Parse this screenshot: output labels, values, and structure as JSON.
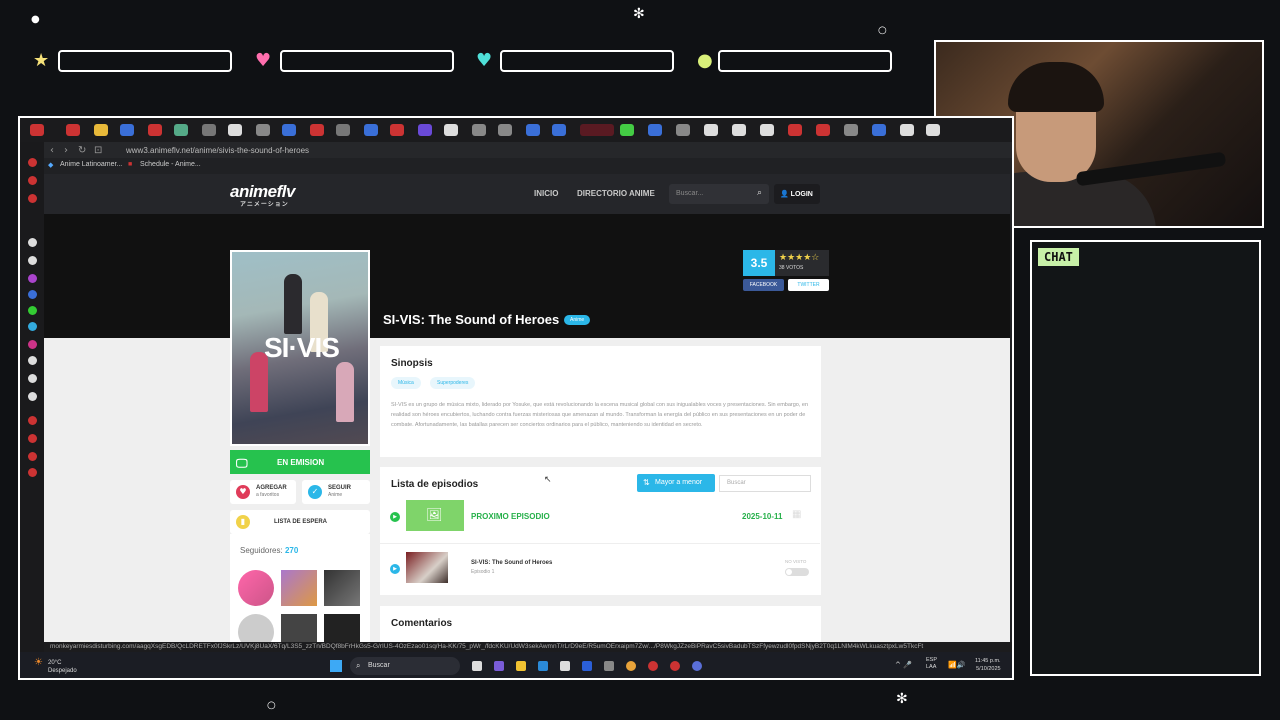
{
  "overlay": {
    "chat_label": "CHAT"
  },
  "browser": {
    "url": "www3.animeflv.net/anime/sivis-the-sound-of-heroes",
    "active_tab": "SI-VIS",
    "bookmarks": [
      "Anime Latinoamer...",
      "Schedule - Anime..."
    ],
    "status_url": "monkeyarmiesdisturbing.com/aagqXsgEDB/QcLDRETFx0fJSkrLz/UVKj8UaX/6Tq/L3S5_zzTn/BDQf8bFrHkGs5-G/rIUS-4OzEzao01sq/Ha-KK/75_pWr_/fdcKKU/UdW3sekAwmnT/rLrD9eE/R5umOErxaipm7Zw/.../P8WkgJZzeBiPRavC5sivBadubTSzFfyewzudl0fpdSNjyB2T0q1LNlM4kWLkuasztpxLw5TkcFt"
  },
  "site": {
    "logo": "animeflv",
    "logo_sub": "アニメーション",
    "nav": [
      "INICIO",
      "DIRECTORIO ANIME"
    ],
    "search_placeholder": "Buscar...",
    "login": "LOGIN"
  },
  "anime": {
    "title": "SI-VIS: The Sound of Heroes",
    "type": "Anime",
    "rating": "3.5",
    "stars": "★★★★☆",
    "votes": "38 VOTOS",
    "share": [
      "FACEBOOK",
      "TWITTER"
    ],
    "status": "EN EMISION",
    "add_fav": [
      "AGREGAR",
      "a favoritos"
    ],
    "follow": [
      "SEGUIR",
      "Anime"
    ],
    "watchlist": "LISTA DE ESPERA",
    "followers_label": "Seguidores:",
    "followers_count": "270",
    "cover_logo": "SI·VIS"
  },
  "synopsis": {
    "heading": "Sinopsis",
    "genres": [
      "Música",
      "Superpoderes"
    ],
    "text": "SI-VIS es un grupo de música mixto, liderado por Yosuke, que está revolucionando la escena musical global con sus inigualables voces y presentaciones. Sin embargo, en realidad son héroes encubiertos, luchando contra fuerzas misteriosas que amenazan al mundo. Transforman la energía del público en sus presentaciones en un poder de combate. Afortunadamente, las batallas parecen ser conciertos ordinarios para el público, manteniendo su identidad en secreto."
  },
  "episodes": {
    "heading": "Lista de episodios",
    "order_button": "Mayor a menor",
    "search_placeholder": "Buscar",
    "next_label": "PROXIMO EPISODIO",
    "next_date": "2025-10-11",
    "items": [
      {
        "title": "SI-VIS: The Sound of Heroes",
        "number": "Episodio 1",
        "status": "NO VISTO"
      }
    ]
  },
  "comments": {
    "heading": "Comentarios"
  },
  "taskbar": {
    "temp": "20°C",
    "weather": "Despejado",
    "search": "Buscar",
    "lang_top": "ESP",
    "lang_bottom": "LAA",
    "time": "11:45 p.m.",
    "date": "5/10/2025"
  }
}
